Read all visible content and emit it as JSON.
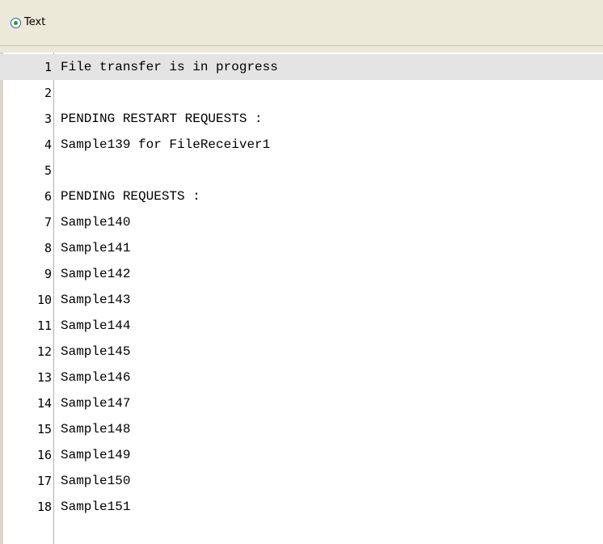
{
  "header": {
    "label": "Text"
  },
  "editor": {
    "current_line": 1,
    "lines": [
      {
        "num": "1",
        "text": "File transfer is in progress"
      },
      {
        "num": "2",
        "text": ""
      },
      {
        "num": "3",
        "text": "PENDING RESTART REQUESTS :"
      },
      {
        "num": "4",
        "text": "Sample139 for FileReceiver1"
      },
      {
        "num": "5",
        "text": ""
      },
      {
        "num": "6",
        "text": "PENDING REQUESTS :"
      },
      {
        "num": "7",
        "text": "Sample140"
      },
      {
        "num": "8",
        "text": "Sample141"
      },
      {
        "num": "9",
        "text": "Sample142"
      },
      {
        "num": "10",
        "text": "Sample143"
      },
      {
        "num": "11",
        "text": "Sample144"
      },
      {
        "num": "12",
        "text": "Sample145"
      },
      {
        "num": "13",
        "text": "Sample146"
      },
      {
        "num": "14",
        "text": "Sample147"
      },
      {
        "num": "15",
        "text": "Sample148"
      },
      {
        "num": "16",
        "text": "Sample149"
      },
      {
        "num": "17",
        "text": "Sample150"
      },
      {
        "num": "18",
        "text": "Sample151"
      }
    ]
  }
}
